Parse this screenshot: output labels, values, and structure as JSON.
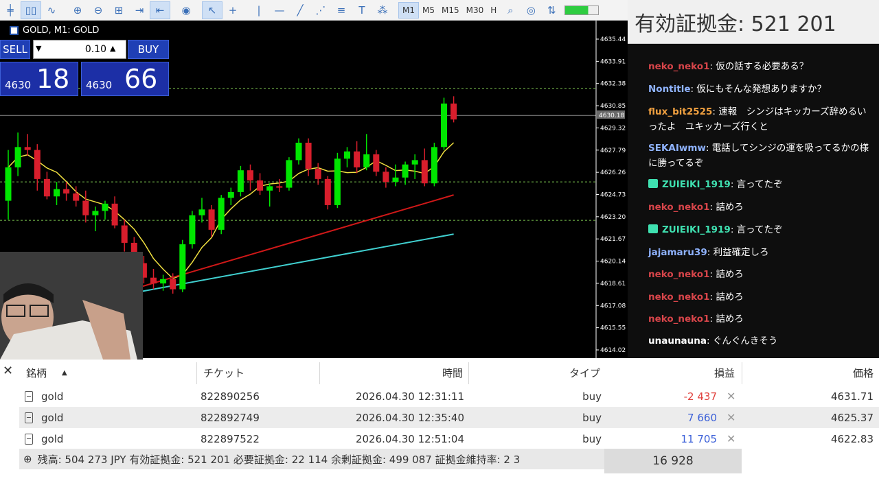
{
  "toolbar": {
    "timeframes": [
      "M1",
      "M5",
      "M15",
      "M30",
      "H"
    ],
    "active_timeframe": "M1"
  },
  "chart": {
    "symbol": "GOLD, M1: GOLD",
    "price_axis": [
      "4635.44",
      "4633.91",
      "4632.38",
      "4630.85",
      "4629.32",
      "4627.79",
      "4626.26",
      "4624.73",
      "4623.20",
      "4621.67",
      "4620.14",
      "4618.61",
      "4617.08",
      "4615.55",
      "4614.02"
    ],
    "current_price_label": "4630.18",
    "colors": {
      "background": "#000000",
      "bull": "#00e600",
      "bear": "#d81e2c",
      "ma_fast": "#f0e040",
      "ma_mid": "#d01818",
      "ma_slow": "#40d0d0",
      "levels": "#7ec850"
    }
  },
  "trade_panel": {
    "sell_label": "SELL",
    "buy_label": "BUY",
    "lot": "0.10",
    "sell_prefix": "4630",
    "sell_big": "18",
    "buy_prefix": "4630",
    "buy_big": "66"
  },
  "balance_overlay": "有効証拠金: 521 201 ",
  "chat": [
    {
      "user": "neko_neko1",
      "color": "#d8454a",
      "text": "仮の話する必要ある？",
      "gift": false
    },
    {
      "user": "Nontitle",
      "color": "#8fb3ff",
      "text": "仮にもそんな発想ありますか？",
      "gift": false
    },
    {
      "user": "flux_bit2525",
      "color": "#f0a040",
      "text": "速報　シンジはキッカーズ辞めるいったよ　ユキッカーズ行くと",
      "gift": false
    },
    {
      "user": "SEKAIwmw",
      "color": "#8fb3ff",
      "text": "電話してシンジの運を吸ってるかの様に勝ってるぞ",
      "gift": false
    },
    {
      "user": "ZUIEIKI_1919",
      "color": "#3fe0b0",
      "text": "言ってたぞ",
      "gift": true
    },
    {
      "user": "neko_neko1",
      "color": "#d8454a",
      "text": "詰めろ",
      "gift": false
    },
    {
      "user": "ZUIEIKI_1919",
      "color": "#3fe0b0",
      "text": "言ってたぞ",
      "gift": true
    },
    {
      "user": "jajamaru39",
      "color": "#8fb3ff",
      "text": "利益確定しろ",
      "gift": false
    },
    {
      "user": "neko_neko1",
      "color": "#d8454a",
      "text": "詰めろ",
      "gift": false
    },
    {
      "user": "neko_neko1",
      "color": "#d8454a",
      "text": "詰めろ",
      "gift": false
    },
    {
      "user": "neko_neko1",
      "color": "#d8454a",
      "text": "詰めろ",
      "gift": false
    },
    {
      "user": "unaunauna",
      "color": "#ffffff",
      "text": "ぐんぐんきそう",
      "gift": false
    }
  ],
  "table": {
    "headers": [
      "銘柄",
      "チケット",
      "時間",
      "タイプ",
      "損益",
      "価格"
    ],
    "rows": [
      {
        "symbol": "gold",
        "ticket": "822890256",
        "time": "2026.04.30 12:31:11",
        "type": "buy",
        "profit": "-2 437",
        "profit_color": "#e0403c",
        "price": "4631.71"
      },
      {
        "symbol": "gold",
        "ticket": "822892749",
        "time": "2026.04.30 12:35:40",
        "type": "buy",
        "profit": "7 660",
        "profit_color": "#3a5fd8",
        "price": "4625.37"
      },
      {
        "symbol": "gold",
        "ticket": "822897522",
        "time": "2026.04.30 12:51:04",
        "type": "buy",
        "profit": "11 705",
        "profit_color": "#3a5fd8",
        "price": "4622.83"
      }
    ],
    "summary": "残高: 504 273 JPY  有効証拠金: 521 201  必要証拠金: 22 114  余剰証拠金: 499 087  証拠金維持率: 2 3",
    "total_profit": "16 928"
  }
}
